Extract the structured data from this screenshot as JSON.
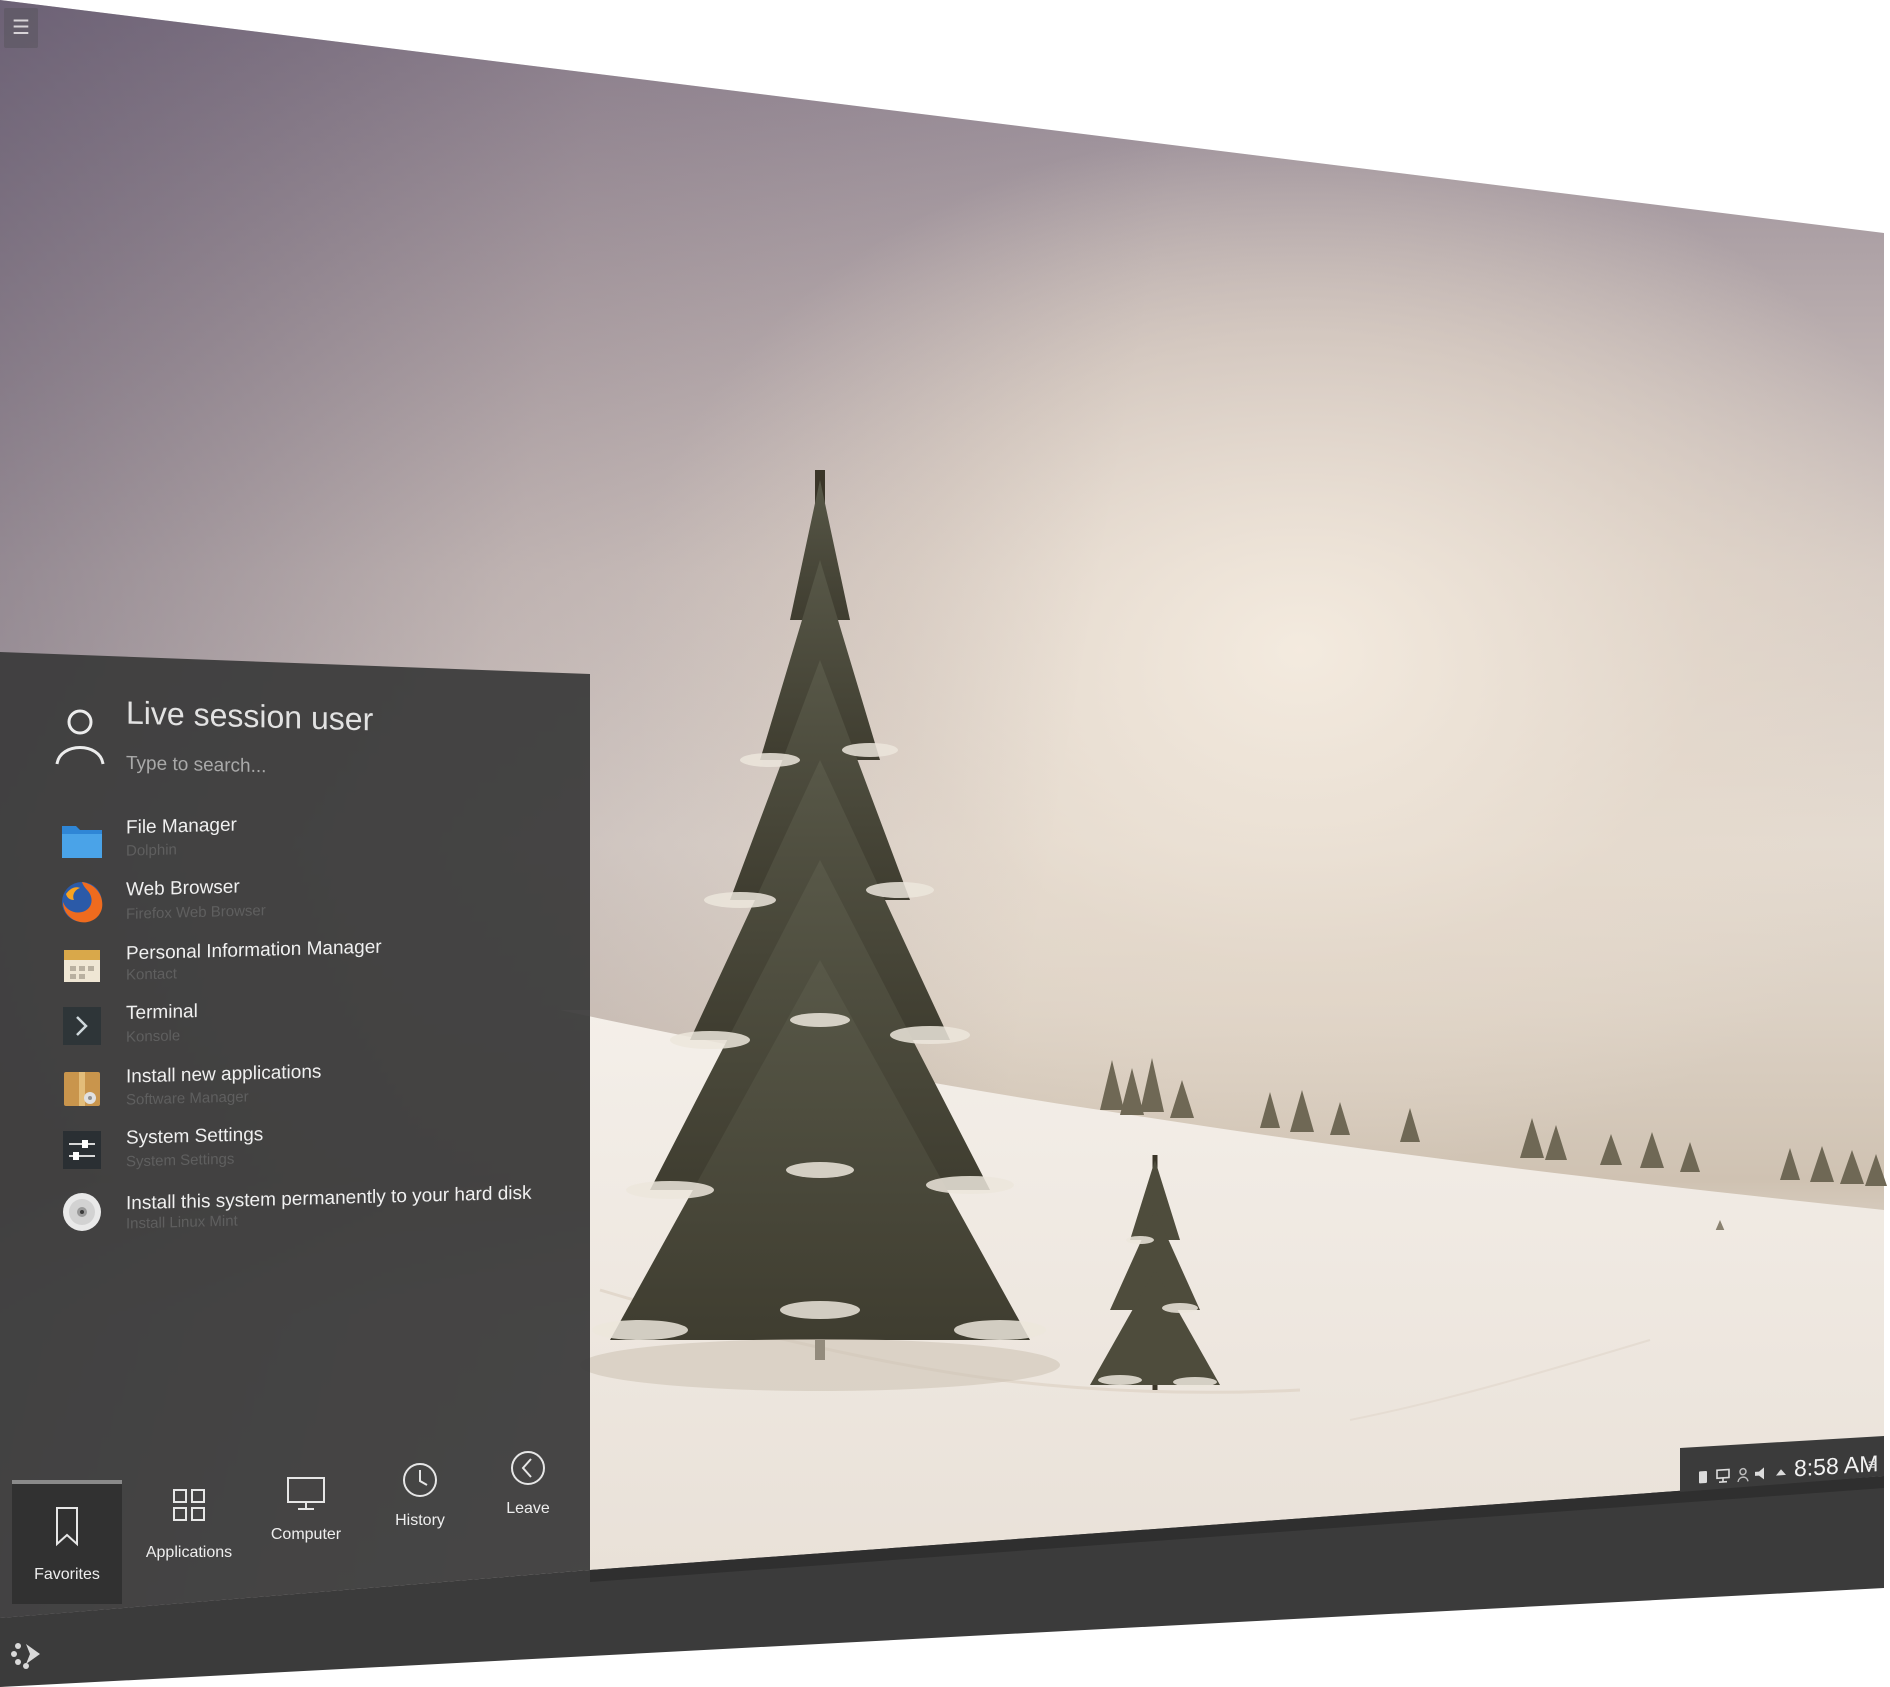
{
  "desktop": {
    "toolbox_icon": "hamburger-icon"
  },
  "menu": {
    "user_name": "Live session user",
    "search_placeholder": "Type to search...",
    "favorites": [
      {
        "title": "File Manager",
        "subtitle": "Dolphin",
        "icon": "folder-icon"
      },
      {
        "title": "Web Browser",
        "subtitle": "Firefox Web Browser",
        "icon": "firefox-icon"
      },
      {
        "title": "Personal Information Manager",
        "subtitle": "Kontact",
        "icon": "calendar-icon"
      },
      {
        "title": "Terminal",
        "subtitle": "Konsole",
        "icon": "terminal-icon"
      },
      {
        "title": "Install new applications",
        "subtitle": "Software Manager",
        "icon": "package-icon"
      },
      {
        "title": "System Settings",
        "subtitle": "System Settings",
        "icon": "settings-icon"
      },
      {
        "title": "Install this system permanently to your hard disk",
        "subtitle": "Install Linux Mint",
        "icon": "disc-icon"
      }
    ],
    "tabs": [
      {
        "label": "Favorites",
        "icon": "bookmark-icon",
        "active": true
      },
      {
        "label": "Applications",
        "icon": "grid-icon",
        "active": false
      },
      {
        "label": "Computer",
        "icon": "monitor-icon",
        "active": false
      },
      {
        "label": "History",
        "icon": "clock-icon",
        "active": false
      },
      {
        "label": "Leave",
        "icon": "back-arrow-icon",
        "active": false
      }
    ]
  },
  "taskbar": {
    "clock": "8:58 AM",
    "tray_icons": [
      "usb-icon",
      "network-icon",
      "user-icon",
      "volume-icon",
      "expand-arrow-icon"
    ],
    "colors": {
      "panel": "#3b3b3b",
      "menu_bg": "#3a3a3a",
      "accent": "#4aa3e8"
    }
  }
}
